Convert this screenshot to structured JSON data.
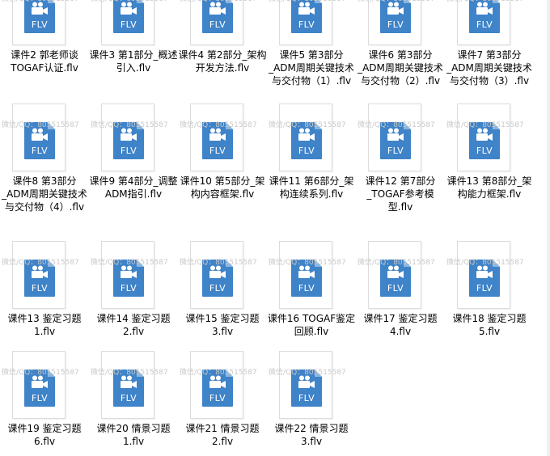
{
  "watermark": "微信/QQ：805515587",
  "ext_label": "FLV",
  "files": [
    {
      "name": "课件2 郭老师谈TOGAF认证.flv"
    },
    {
      "name": "课件3 第1部分_概述引入.flv"
    },
    {
      "name": "课件4 第2部分_架构开发方法.flv"
    },
    {
      "name": "课件5 第3部分_ADM周期关键技术与交付物（1）.flv"
    },
    {
      "name": "课件6 第3部分_ADM周期关键技术与交付物（2）.flv"
    },
    {
      "name": "课件7 第3部分_ADM周期关键技术与交付物（3）.flv"
    },
    {
      "name": "课件8 第3部分_ADM周期关键技术与交付物（4）.flv"
    },
    {
      "name": "课件9 第4部分_调整ADM指引.flv"
    },
    {
      "name": "课件10 第5部分_架构内容框架.flv"
    },
    {
      "name": "课件11 第6部分_架构连续系列.flv"
    },
    {
      "name": "课件12 第7部分_TOGAF参考模型.flv"
    },
    {
      "name": "课件13 第8部分_架构能力框架.flv"
    },
    {
      "name": "课件13 鉴定习题1.flv"
    },
    {
      "name": "课件14 鉴定习题2.flv"
    },
    {
      "name": "课件15 鉴定习题3.flv"
    },
    {
      "name": "课件16 TOGAF鉴定回顾.flv"
    },
    {
      "name": "课件17 鉴定习题4.flv"
    },
    {
      "name": "课件18 鉴定习题5.flv"
    },
    {
      "name": "课件19 鉴定习题6.flv"
    },
    {
      "name": "课件20 情景习题1.flv"
    },
    {
      "name": "课件21 情景习题2.flv"
    },
    {
      "name": "课件22 情景习题3.flv"
    }
  ]
}
